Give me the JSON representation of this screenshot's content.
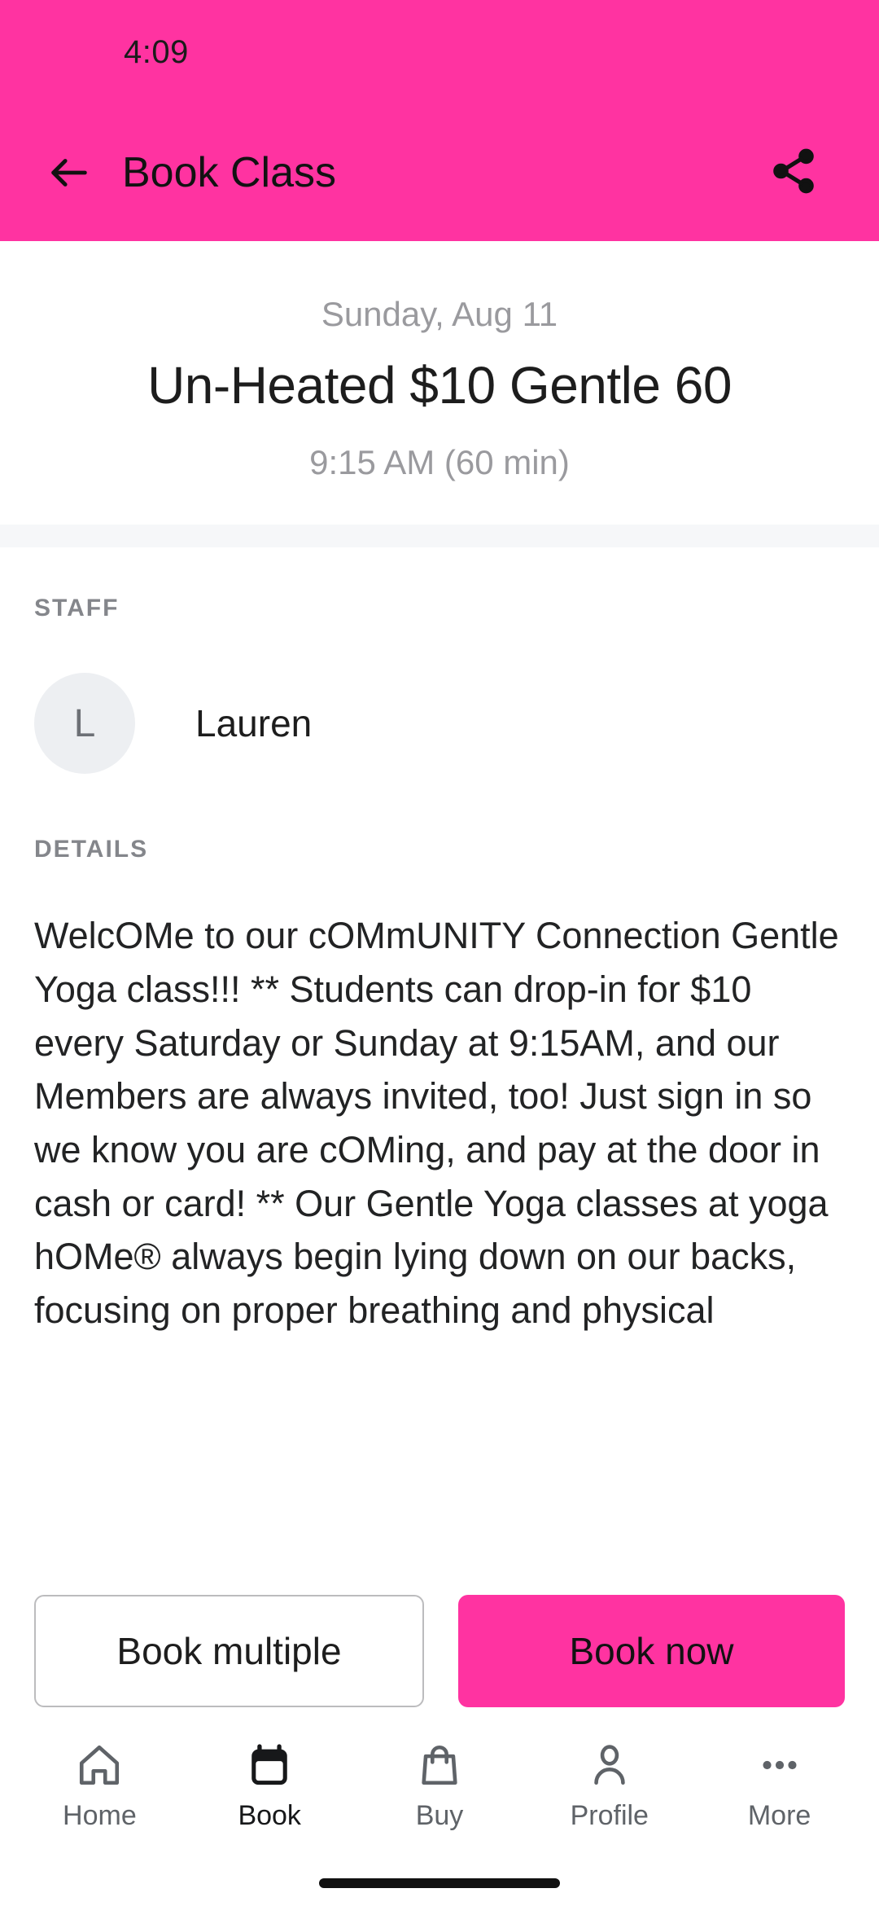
{
  "status_bar": {
    "time": "4:09"
  },
  "app_bar": {
    "title": "Book Class",
    "back_icon": "back-arrow-icon",
    "share_icon": "share-icon"
  },
  "class": {
    "date": "Sunday, Aug 11",
    "title": "Un-Heated $10 Gentle 60",
    "time": "9:15 AM (60 min)"
  },
  "staff": {
    "label": "STAFF",
    "avatar_initial": "L",
    "name": "Lauren"
  },
  "details": {
    "label": "DETAILS",
    "text": "WelcOMe to our cOMmUNITY Connection Gentle Yoga class!!!    ** Students can drop-in for $10 every Saturday or Sunday at 9:15AM, and our Members are always invited, too!  Just sign in so we know you are cOMing, and pay at the door in cash or card!   **   Our Gentle Yoga classes at yoga hOMe® always begin lying down on our backs, focusing on proper breathing and physical"
  },
  "actions": {
    "book_multiple": "Book multiple",
    "book_now": "Book now"
  },
  "bottom_nav": {
    "items": [
      {
        "label": "Home",
        "icon": "home-icon"
      },
      {
        "label": "Book",
        "icon": "calendar-icon"
      },
      {
        "label": "Buy",
        "icon": "shopping-bag-icon"
      },
      {
        "label": "Profile",
        "icon": "person-icon"
      },
      {
        "label": "More",
        "icon": "ellipsis-icon"
      }
    ],
    "active_index": 1
  },
  "colors": {
    "brand_pink": "#FF33A1",
    "band_gray": "#F6F7F9",
    "avatar_gray": "#EDEFF2",
    "muted_text": "#9a9a9e"
  }
}
